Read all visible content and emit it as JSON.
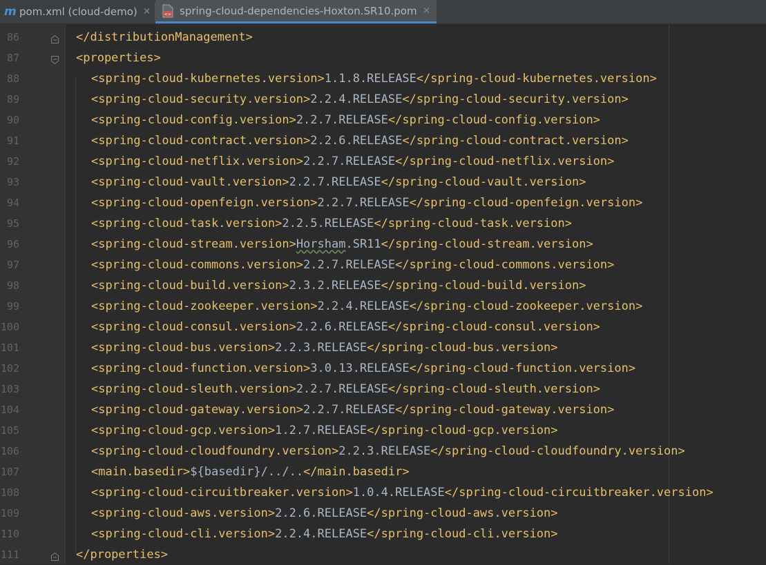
{
  "tabs": [
    {
      "label": "pom.xml (cloud-demo)",
      "icon": "maven-m-icon",
      "active": false
    },
    {
      "label": "spring-cloud-dependencies-Hoxton.SR10.pom",
      "icon": "xml-file-icon",
      "active": true
    }
  ],
  "editor": {
    "lines": [
      {
        "num": "86",
        "indent": 0,
        "tag_open": "</distributionManagement>",
        "value": "",
        "tag_close": "",
        "fold": "end"
      },
      {
        "num": "87",
        "indent": 0,
        "tag_open": "<properties>",
        "value": "",
        "tag_close": "",
        "fold": "start"
      },
      {
        "num": "88",
        "indent": 1,
        "tag_open": "<spring-cloud-kubernetes.version>",
        "value": "1.1.8.RELEASE",
        "tag_close": "</spring-cloud-kubernetes.version>"
      },
      {
        "num": "89",
        "indent": 1,
        "tag_open": "<spring-cloud-security.version>",
        "value": "2.2.4.RELEASE",
        "tag_close": "</spring-cloud-security.version>"
      },
      {
        "num": "90",
        "indent": 1,
        "tag_open": "<spring-cloud-config.version>",
        "value": "2.2.7.RELEASE",
        "tag_close": "</spring-cloud-config.version>"
      },
      {
        "num": "91",
        "indent": 1,
        "tag_open": "<spring-cloud-contract.version>",
        "value": "2.2.6.RELEASE",
        "tag_close": "</spring-cloud-contract.version>"
      },
      {
        "num": "92",
        "indent": 1,
        "tag_open": "<spring-cloud-netflix.version>",
        "value": "2.2.7.RELEASE",
        "tag_close": "</spring-cloud-netflix.version>"
      },
      {
        "num": "93",
        "indent": 1,
        "tag_open": "<spring-cloud-vault.version>",
        "value": "2.2.7.RELEASE",
        "tag_close": "</spring-cloud-vault.version>"
      },
      {
        "num": "94",
        "indent": 1,
        "tag_open": "<spring-cloud-openfeign.version>",
        "value": "2.2.7.RELEASE",
        "tag_close": "</spring-cloud-openfeign.version>"
      },
      {
        "num": "95",
        "indent": 1,
        "tag_open": "<spring-cloud-task.version>",
        "value": "2.2.5.RELEASE",
        "tag_close": "</spring-cloud-task.version>"
      },
      {
        "num": "96",
        "indent": 1,
        "tag_open": "<spring-cloud-stream.version>",
        "value": "Horsham.SR11",
        "tag_close": "</spring-cloud-stream.version>",
        "squiggle": "Horsham"
      },
      {
        "num": "97",
        "indent": 1,
        "tag_open": "<spring-cloud-commons.version>",
        "value": "2.2.7.RELEASE",
        "tag_close": "</spring-cloud-commons.version>"
      },
      {
        "num": "98",
        "indent": 1,
        "tag_open": "<spring-cloud-build.version>",
        "value": "2.3.2.RELEASE",
        "tag_close": "</spring-cloud-build.version>"
      },
      {
        "num": "99",
        "indent": 1,
        "tag_open": "<spring-cloud-zookeeper.version>",
        "value": "2.2.4.RELEASE",
        "tag_close": "</spring-cloud-zookeeper.version>"
      },
      {
        "num": "100",
        "indent": 1,
        "tag_open": "<spring-cloud-consul.version>",
        "value": "2.2.6.RELEASE",
        "tag_close": "</spring-cloud-consul.version>"
      },
      {
        "num": "101",
        "indent": 1,
        "tag_open": "<spring-cloud-bus.version>",
        "value": "2.2.3.RELEASE",
        "tag_close": "</spring-cloud-bus.version>"
      },
      {
        "num": "102",
        "indent": 1,
        "tag_open": "<spring-cloud-function.version>",
        "value": "3.0.13.RELEASE",
        "tag_close": "</spring-cloud-function.version>"
      },
      {
        "num": "103",
        "indent": 1,
        "tag_open": "<spring-cloud-sleuth.version>",
        "value": "2.2.7.RELEASE",
        "tag_close": "</spring-cloud-sleuth.version>"
      },
      {
        "num": "104",
        "indent": 1,
        "tag_open": "<spring-cloud-gateway.version>",
        "value": "2.2.7.RELEASE",
        "tag_close": "</spring-cloud-gateway.version>"
      },
      {
        "num": "105",
        "indent": 1,
        "tag_open": "<spring-cloud-gcp.version>",
        "value": "1.2.7.RELEASE",
        "tag_close": "</spring-cloud-gcp.version>"
      },
      {
        "num": "106",
        "indent": 1,
        "tag_open": "<spring-cloud-cloudfoundry.version>",
        "value": "2.2.3.RELEASE",
        "tag_close": "</spring-cloud-cloudfoundry.version>"
      },
      {
        "num": "107",
        "indent": 1,
        "tag_open": "<main.basedir>",
        "value": "${basedir}/../..",
        "tag_close": "</main.basedir>"
      },
      {
        "num": "108",
        "indent": 1,
        "tag_open": "<spring-cloud-circuitbreaker.version>",
        "value": "1.0.4.RELEASE",
        "tag_close": "</spring-cloud-circuitbreaker.version>"
      },
      {
        "num": "109",
        "indent": 1,
        "tag_open": "<spring-cloud-aws.version>",
        "value": "2.2.6.RELEASE",
        "tag_close": "</spring-cloud-aws.version>"
      },
      {
        "num": "110",
        "indent": 1,
        "tag_open": "<spring-cloud-cli.version>",
        "value": "2.2.4.RELEASE",
        "tag_close": "</spring-cloud-cli.version>"
      },
      {
        "num": "111",
        "indent": 0,
        "tag_open": "</properties>",
        "value": "",
        "tag_close": "",
        "fold": "end"
      }
    ]
  },
  "colors": {
    "background": "#2b2b2b",
    "gutter": "#313335",
    "tag": "#e8bf6a",
    "text": "#a9b7c6",
    "line_number": "#606366",
    "active_tab_underline": "#4a88c7"
  }
}
